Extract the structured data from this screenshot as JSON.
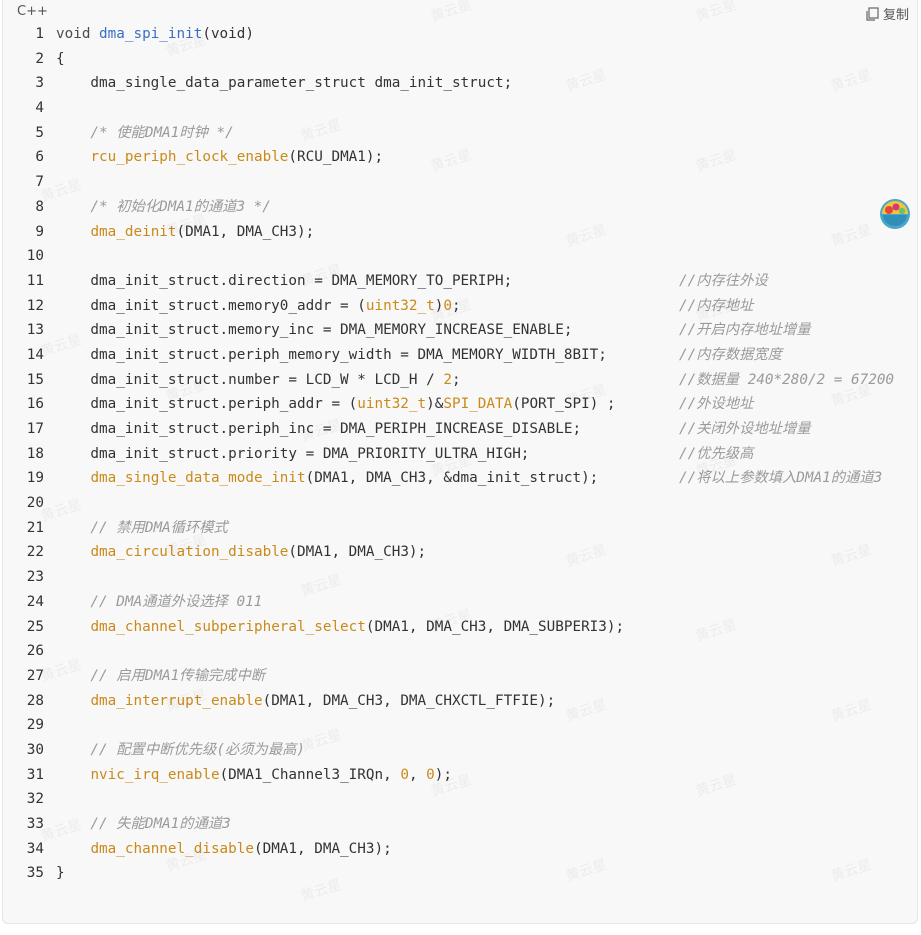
{
  "header": {
    "language": "C++",
    "copy_label": "复制"
  },
  "code": {
    "lines": [
      {
        "n": "1",
        "text": "void dma_spi_init(void)",
        "kind": "def"
      },
      {
        "n": "2",
        "text": "{",
        "kind": "plain"
      },
      {
        "n": "3",
        "text": "    dma_single_data_parameter_struct dma_init_struct;",
        "kind": "plain"
      },
      {
        "n": "4",
        "text": "",
        "kind": "plain"
      },
      {
        "n": "5",
        "text": "    /* 使能DMA1时钟 */",
        "kind": "comment"
      },
      {
        "n": "6",
        "text": "    rcu_periph_clock_enable(RCU_DMA1);",
        "kind": "call",
        "fn": "rcu_periph_clock_enable",
        "args": "(RCU_DMA1);"
      },
      {
        "n": "7",
        "text": "",
        "kind": "plain"
      },
      {
        "n": "8",
        "text": "    /* 初始化DMA1的通道3 */",
        "kind": "comment"
      },
      {
        "n": "9",
        "text": "    dma_deinit(DMA1, DMA_CH3);",
        "kind": "call",
        "fn": "dma_deinit",
        "args": "(DMA1, DMA_CH3);"
      },
      {
        "n": "10",
        "text": "",
        "kind": "plain"
      },
      {
        "n": "11",
        "text": "    dma_init_struct.direction = DMA_MEMORY_TO_PERIPH;",
        "kind": "assign",
        "trail": "//内存往外设"
      },
      {
        "n": "12",
        "text": "    dma_init_struct.memory0_addr = (uint32_t)0;",
        "kind": "cast",
        "pre": "    dma_init_struct.memory0_addr = (",
        "ty": "uint32_t",
        "post": ")",
        "num": "0",
        "end": ";",
        "trail": "//内存地址"
      },
      {
        "n": "13",
        "text": "    dma_init_struct.memory_inc = DMA_MEMORY_INCREASE_ENABLE;",
        "kind": "assign",
        "trail": "//开启内存地址增量"
      },
      {
        "n": "14",
        "text": "    dma_init_struct.periph_memory_width = DMA_MEMORY_WIDTH_8BIT;",
        "kind": "assign",
        "trail": "//内存数据宽度"
      },
      {
        "n": "15",
        "text": "    dma_init_struct.number = LCD_W * LCD_H / 2;",
        "kind": "numend",
        "pre": "    dma_init_struct.number = LCD_W * LCD_H / ",
        "num": "2",
        "end": ";",
        "trail": "//数据量 240*280/2 = 67200"
      },
      {
        "n": "16",
        "text": "    dma_init_struct.periph_addr = (uint32_t)&SPI_DATA(PORT_SPI) ;",
        "kind": "cast2",
        "pre": "    dma_init_struct.periph_addr = (",
        "ty": "uint32_t",
        "mid": ")&",
        "mac": "SPI_DATA",
        "end": "(PORT_SPI) ;",
        "trail": "//外设地址"
      },
      {
        "n": "17",
        "text": "    dma_init_struct.periph_inc = DMA_PERIPH_INCREASE_DISABLE;",
        "kind": "assign",
        "trail": "//关闭外设地址增量"
      },
      {
        "n": "18",
        "text": "    dma_init_struct.priority = DMA_PRIORITY_ULTRA_HIGH;",
        "kind": "assign",
        "trail": "//优先级高"
      },
      {
        "n": "19",
        "text": "    dma_single_data_mode_init(DMA1, DMA_CH3, &dma_init_struct);",
        "kind": "call",
        "fn": "dma_single_data_mode_init",
        "args": "(DMA1, DMA_CH3, &dma_init_struct);",
        "trail": "//将以上参数填入DMA1的通道3"
      },
      {
        "n": "20",
        "text": "",
        "kind": "plain"
      },
      {
        "n": "21",
        "text": "    // 禁用DMA循环模式",
        "kind": "comment"
      },
      {
        "n": "22",
        "text": "    dma_circulation_disable(DMA1, DMA_CH3);",
        "kind": "call",
        "fn": "dma_circulation_disable",
        "args": "(DMA1, DMA_CH3);"
      },
      {
        "n": "23",
        "text": "",
        "kind": "plain"
      },
      {
        "n": "24",
        "text": "    // DMA通道外设选择 011",
        "kind": "comment"
      },
      {
        "n": "25",
        "text": "    dma_channel_subperipheral_select(DMA1, DMA_CH3, DMA_SUBPERI3);",
        "kind": "call",
        "fn": "dma_channel_subperipheral_select",
        "args": "(DMA1, DMA_CH3, DMA_SUBPERI3);"
      },
      {
        "n": "26",
        "text": "",
        "kind": "plain"
      },
      {
        "n": "27",
        "text": "    // 启用DMA1传输完成中断",
        "kind": "comment"
      },
      {
        "n": "28",
        "text": "    dma_interrupt_enable(DMA1, DMA_CH3, DMA_CHXCTL_FTFIE);",
        "kind": "call",
        "fn": "dma_interrupt_enable",
        "args": "(DMA1, DMA_CH3, DMA_CHXCTL_FTFIE);"
      },
      {
        "n": "29",
        "text": "",
        "kind": "plain"
      },
      {
        "n": "30",
        "text": "    // 配置中断优先级(必须为最高)",
        "kind": "comment"
      },
      {
        "n": "31",
        "text": "    nvic_irq_enable(DMA1_Channel3_IRQn, 0, 0);",
        "kind": "nvic",
        "fn": "nvic_irq_enable",
        "a": "(DMA1_Channel3_IRQn, ",
        "n1": "0",
        "b": ", ",
        "n2": "0",
        "c": ");"
      },
      {
        "n": "32",
        "text": "",
        "kind": "plain"
      },
      {
        "n": "33",
        "text": "    // 失能DMA1的通道3",
        "kind": "comment"
      },
      {
        "n": "34",
        "text": "    dma_channel_disable(DMA1, DMA_CH3);",
        "kind": "call",
        "fn": "dma_channel_disable",
        "args": "(DMA1, DMA_CH3);"
      },
      {
        "n": "35",
        "text": "}",
        "kind": "plain"
      }
    ]
  },
  "watermark_text": "黄云星",
  "colors": {
    "function": "#c98a1a",
    "definition": "#3a6fc4",
    "comment": "#9a9a9a",
    "text": "#333333"
  }
}
